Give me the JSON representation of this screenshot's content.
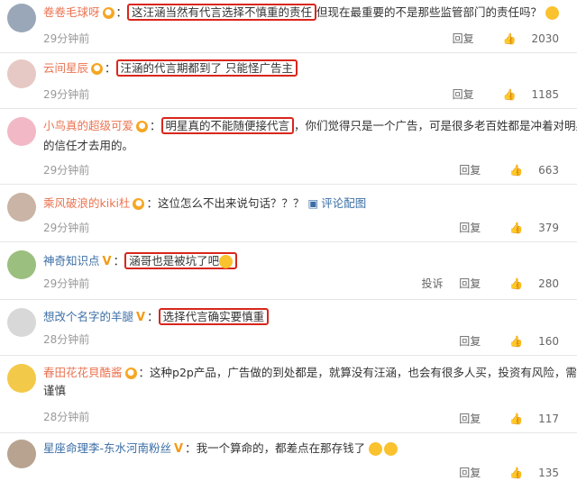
{
  "comments": [
    {
      "user": "卷卷毛球呀",
      "colon": "：",
      "highlight": "这汪涵当然有代言选择不慎重的责任",
      "rest": "但现在最重要的不是那些监管部门的责任吗？",
      "time": "29分钟前",
      "reply": "回复",
      "likes": "2030"
    },
    {
      "user": "云间星辰",
      "colon": "：",
      "highlight": "汪涵的代言期都到了 只能怪广告主",
      "rest": "",
      "time": "29分钟前",
      "reply": "回复",
      "likes": "1185"
    },
    {
      "user": "小鸟真的超级可爱",
      "colon": "：",
      "highlight": "明星真的不能随便接代言",
      "rest": "，你们觉得只是一个广告，可是很多老百姓都是冲着对明星",
      "rest2": "的信任才去用的。",
      "time": "29分钟前",
      "reply": "回复",
      "likes": "663"
    },
    {
      "user": "乘风破浪的kiki杜",
      "colon": "：",
      "highlight": "",
      "rest": "这位怎么不出来说句话？？？",
      "link": "评论配图",
      "time": "29分钟前",
      "reply": "回复",
      "likes": "379"
    },
    {
      "user": "神奇知识点",
      "colon": "：",
      "highlight": "涵哥也是被坑了吧",
      "rest": "",
      "time": "29分钟前",
      "report": "投诉",
      "reply": "回复",
      "likes": "280"
    },
    {
      "user": "想改个名字的羊腿",
      "colon": "：",
      "highlight": "选择代言确实要慎重",
      "rest": "",
      "time": "28分钟前",
      "reply": "回复",
      "likes": "160"
    },
    {
      "user": "春田花花貝酷酱",
      "colon": "：",
      "highlight": "",
      "rest": "这种p2p产品，广告做的到处都是，就算没有汪涵，也会有很多人买，投资有风险，需",
      "rest2": "谨慎",
      "time": "28分钟前",
      "reply": "回复",
      "likes": "117"
    },
    {
      "user": "星座命理李-东水河南粉丝",
      "colon": "：",
      "highlight": "",
      "rest": "我一个算命的，都差点在那存钱了",
      "time": "",
      "reply": "回复",
      "likes": "135"
    }
  ],
  "icons": {
    "thumb": "thumbs-up-icon",
    "badge": "vip-badge-icon"
  }
}
